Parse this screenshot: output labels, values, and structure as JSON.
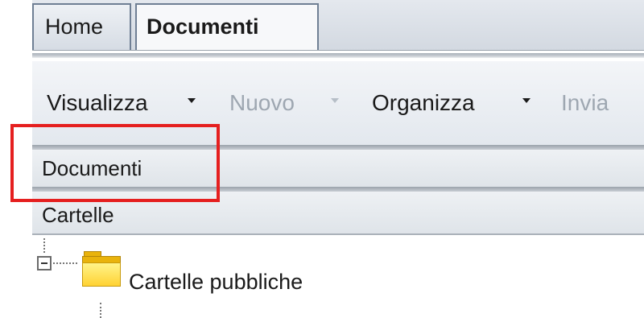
{
  "tabs": [
    {
      "label": "Home",
      "active": false
    },
    {
      "label": "Documenti",
      "active": true
    }
  ],
  "toolbar": {
    "items": [
      {
        "label": "Visualizza",
        "enabled": true,
        "has_dropdown": true
      },
      {
        "label": "Nuovo",
        "enabled": false,
        "has_dropdown": true
      },
      {
        "label": "Organizza",
        "enabled": true,
        "has_dropdown": true
      },
      {
        "label": "Invia",
        "enabled": false,
        "has_dropdown": false
      }
    ]
  },
  "panels": {
    "documenti_header": "Documenti",
    "cartelle_header": "Cartelle"
  },
  "tree": {
    "items": [
      {
        "label": "Cartelle pubbliche",
        "icon": "folder-icon",
        "expanded": true
      }
    ]
  },
  "colors": {
    "highlight": "#e51f1f",
    "folder": "#e9b30c"
  }
}
